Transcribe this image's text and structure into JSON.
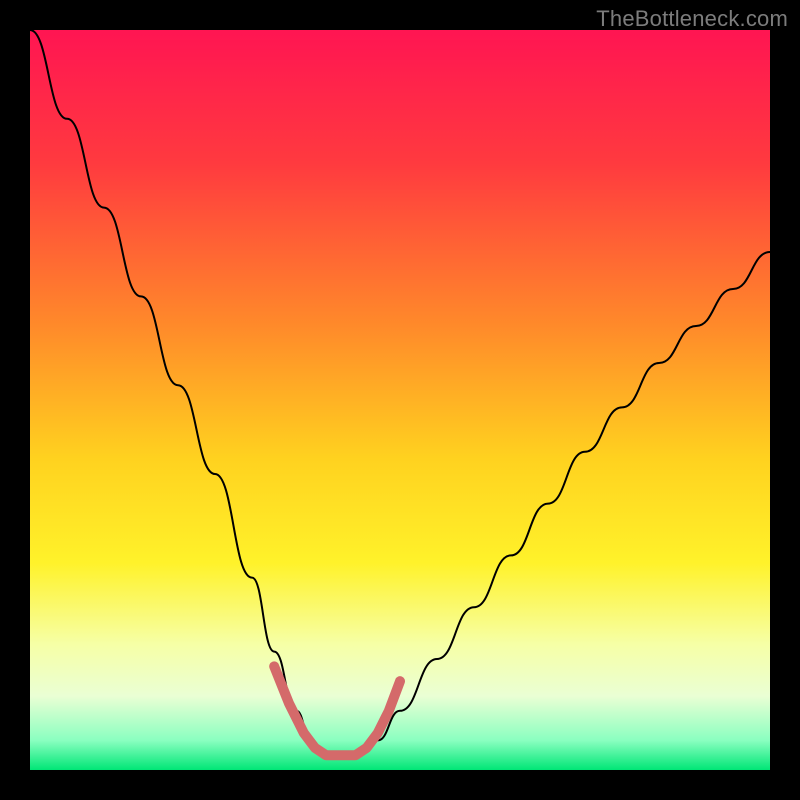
{
  "watermark": "TheBottleneck.com",
  "chart_data": {
    "type": "line",
    "title": "",
    "xlabel": "",
    "ylabel": "",
    "xlim": [
      0,
      100
    ],
    "ylim": [
      0,
      100
    ],
    "grid": false,
    "legend": false,
    "gradient_stops": [
      {
        "pct": 0,
        "color": "#ff1552"
      },
      {
        "pct": 18,
        "color": "#ff3a3f"
      },
      {
        "pct": 40,
        "color": "#ff8a2a"
      },
      {
        "pct": 58,
        "color": "#ffd21f"
      },
      {
        "pct": 72,
        "color": "#fff22a"
      },
      {
        "pct": 83,
        "color": "#f6ffa6"
      },
      {
        "pct": 90,
        "color": "#eaffd4"
      },
      {
        "pct": 96,
        "color": "#8affc0"
      },
      {
        "pct": 100,
        "color": "#00e676"
      }
    ],
    "series": [
      {
        "name": "bottleneck-curve",
        "stroke": "#000000",
        "stroke_width": 2,
        "x": [
          0,
          5,
          10,
          15,
          20,
          25,
          30,
          33,
          36,
          38,
          40,
          44,
          47,
          50,
          55,
          60,
          65,
          70,
          75,
          80,
          85,
          90,
          95,
          100
        ],
        "y": [
          100,
          88,
          76,
          64,
          52,
          40,
          26,
          16,
          8,
          4,
          2,
          2,
          4,
          8,
          15,
          22,
          29,
          36,
          43,
          49,
          55,
          60,
          65,
          70
        ]
      },
      {
        "name": "trough-marker",
        "stroke": "#d46a6a",
        "stroke_width": 10,
        "x": [
          33,
          35,
          37,
          38.5,
          40,
          42,
          44,
          45.5,
          47,
          48.5,
          50
        ],
        "y": [
          14,
          9,
          5,
          3,
          2,
          2,
          2,
          3,
          5,
          8,
          12
        ]
      }
    ]
  }
}
